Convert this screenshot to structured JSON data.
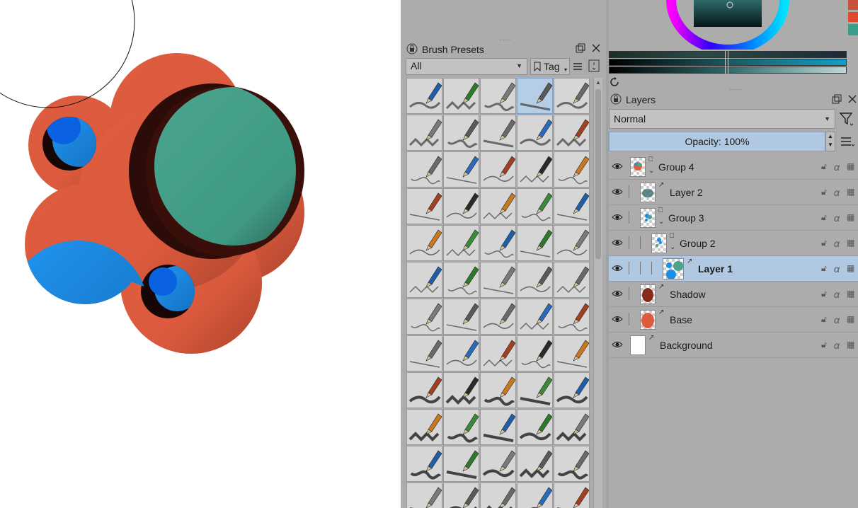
{
  "brush_presets": {
    "title": "Brush Presets",
    "filter_value": "All",
    "tag_label": "Tag",
    "icons": [
      "lock-icon",
      "float-icon",
      "close-icon",
      "list-view-icon",
      "display-settings-icon"
    ]
  },
  "layers": {
    "title": "Layers",
    "blend_mode": "Normal",
    "opacity_label": "Opacity:",
    "opacity_value": "100%",
    "items": [
      {
        "name": "Group 4",
        "type": "group",
        "depth": 0
      },
      {
        "name": "Layer 2",
        "type": "paint",
        "depth": 1
      },
      {
        "name": "Group 3",
        "type": "group",
        "depth": 1
      },
      {
        "name": "Group 2",
        "type": "group",
        "depth": 2
      },
      {
        "name": "Layer 1",
        "type": "paint",
        "depth": 3,
        "selected": true
      },
      {
        "name": "Shadow",
        "type": "paint",
        "depth": 1
      },
      {
        "name": "Base",
        "type": "paint",
        "depth": 1
      },
      {
        "name": "Background",
        "type": "paint",
        "depth": 0
      }
    ]
  },
  "colors": {
    "canvas_orange": "#dd5b3e",
    "canvas_teal": "#4aa38c",
    "canvas_blue": "#1b8fe8",
    "selection": "#b1c8e2",
    "panel_bg": "#acacac"
  }
}
